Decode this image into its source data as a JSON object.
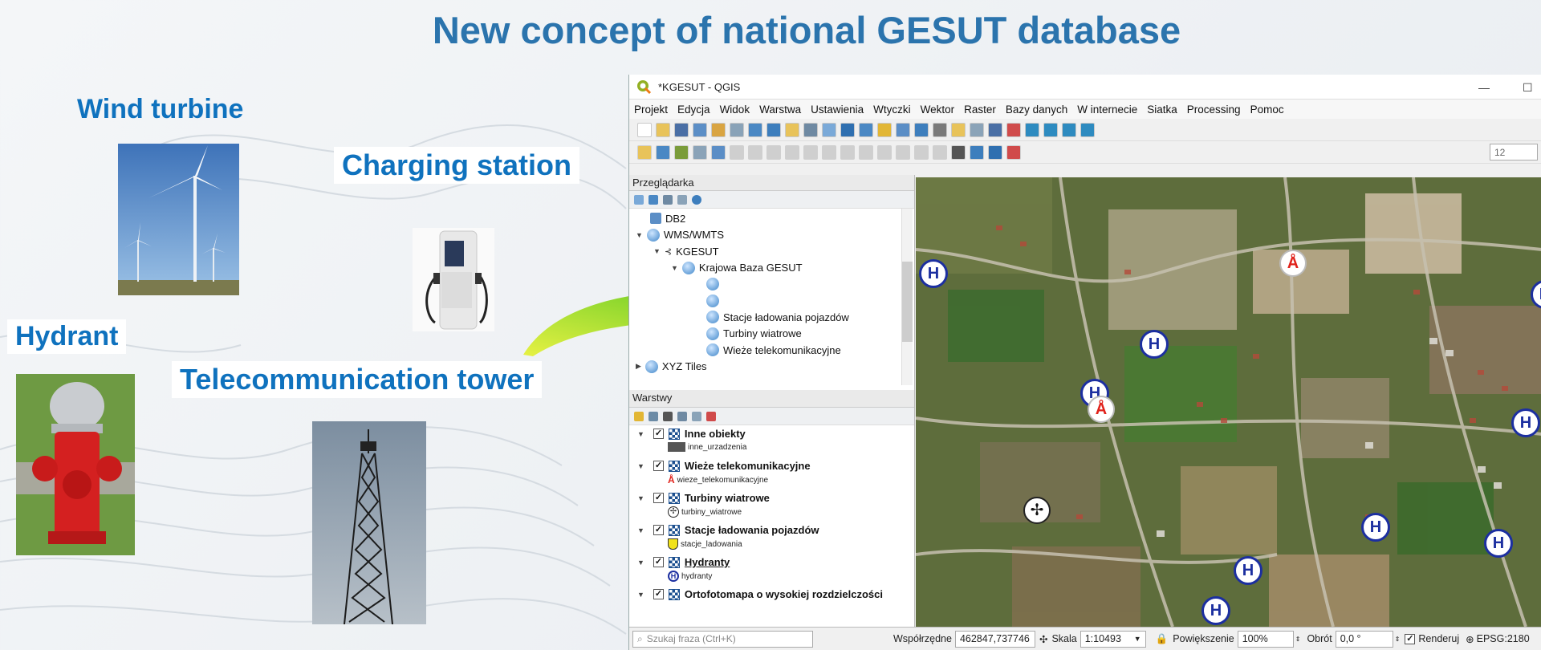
{
  "slide": {
    "title": "New concept of national GESUT database"
  },
  "labels": {
    "wind": "Wind turbine",
    "charging": "Charging station",
    "hydrant": "Hydrant",
    "tower": "Telecommunication tower"
  },
  "qgis": {
    "window_title": "*KGESUT - QGIS",
    "menu": [
      "Projekt",
      "Edycja",
      "Widok",
      "Warstwa",
      "Ustawienia",
      "Wtyczki",
      "Wektor",
      "Raster",
      "Bazy danych",
      "W internecie",
      "Siatka",
      "Processing",
      "Pomoc"
    ],
    "browser": {
      "title": "Przeglądarka",
      "items": [
        {
          "label": "DB2"
        },
        {
          "label": "WMS/WMTS"
        },
        {
          "label": "KGESUT"
        },
        {
          "label": "Krajowa Baza GESUT"
        },
        {
          "label": "Stacje ładowania pojazdów"
        },
        {
          "label": "Turbiny wiatrowe"
        },
        {
          "label": "Wieże telekomunikacyjne"
        },
        {
          "label": "XYZ Tiles"
        }
      ]
    },
    "layers": {
      "title": "Warstwy",
      "items": [
        {
          "name": "Inne obiekty",
          "sub": "inne_urzadzenia"
        },
        {
          "name": "Wieże telekomunikacyjne",
          "sub": "wieze_telekomunikacyjne"
        },
        {
          "name": "Turbiny wiatrowe",
          "sub": "turbiny_wiatrowe"
        },
        {
          "name": "Stacje ładowania pojazdów",
          "sub": "stacje_ladowania"
        },
        {
          "name": "Hydranty",
          "sub": "hydranty"
        },
        {
          "name": "Ortofotomapa o wysokiej rozdzielczości",
          "sub": ""
        }
      ]
    },
    "toolbar": {
      "zoom_value": "12"
    },
    "status": {
      "search_placeholder": "Szukaj fraza (Ctrl+K)",
      "coord_label": "Współrzędne",
      "coord_value": "462847,737746",
      "scale_label": "Skala",
      "scale_value": "1:10493",
      "magnifier_label": "Powiększenie",
      "magnifier_value": "100%",
      "rotation_label": "Obrót",
      "rotation_value": "0,0 °",
      "render_label": "Renderuj",
      "crs": "EPSG:2180"
    },
    "colors": {
      "accent": "#2b74ad",
      "label_blue": "#0f72be",
      "hydrant_marker": "#1c2fa0",
      "tower_marker": "#e0221b"
    }
  }
}
